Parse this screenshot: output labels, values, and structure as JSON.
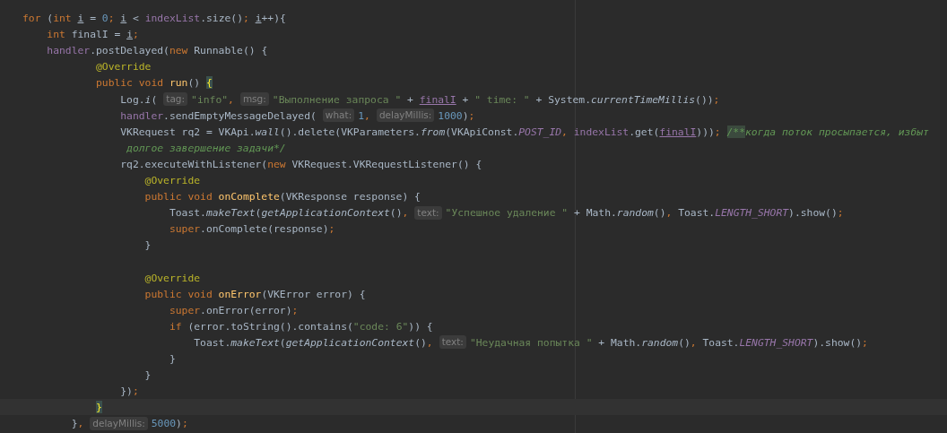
{
  "editor": {
    "lines": [
      {
        "parts": [
          {
            "kind": "code",
            "tokens": [
              {
                "kind": "kw",
                "text": "for"
              },
              {
                "kind": "plain",
                "text": " ("
              },
              {
                "kind": "kw",
                "text": "int "
              },
              {
                "kind": "uvar",
                "text": "i"
              },
              {
                "kind": "plain",
                "text": " = "
              },
              {
                "kind": "num",
                "text": "0"
              },
              {
                "kind": "kw",
                "text": "; "
              },
              {
                "kind": "uvar",
                "text": "i"
              },
              {
                "kind": "plain",
                "text": " < "
              },
              {
                "kind": "field",
                "text": "indexList"
              },
              {
                "kind": "plain",
                "text": ".size()"
              },
              {
                "kind": "kw",
                "text": "; "
              },
              {
                "kind": "uvar",
                "text": "i"
              },
              {
                "kind": "plain",
                "text": "++){"
              }
            ]
          }
        ]
      },
      {
        "parts": [
          {
            "kind": "code",
            "tokens": [
              {
                "kind": "kw",
                "text": "    int"
              },
              {
                "kind": "plain",
                "text": " finalI = "
              },
              {
                "kind": "uvar",
                "text": "i"
              },
              {
                "kind": "kw",
                "text": ";"
              }
            ]
          }
        ]
      },
      {
        "parts": [
          {
            "kind": "code",
            "tokens": [
              {
                "kind": "field",
                "text": "    handler"
              },
              {
                "kind": "plain",
                "text": ".postDelayed("
              },
              {
                "kind": "kw",
                "text": "new"
              },
              {
                "kind": "plain",
                "text": " Runnable() {"
              }
            ]
          }
        ]
      },
      {
        "parts": [
          {
            "kind": "code",
            "tokens": [
              {
                "kind": "ann",
                "text": "            @Override"
              }
            ]
          }
        ]
      },
      {
        "parts": [
          {
            "kind": "code",
            "tokens": [
              {
                "kind": "kw",
                "text": "            public void "
              },
              {
                "kind": "decl",
                "text": "run"
              },
              {
                "kind": "plain",
                "text": "() "
              },
              {
                "kind": "brace",
                "text": "{"
              }
            ]
          }
        ]
      },
      {
        "parts": [
          {
            "kind": "code",
            "tokens": [
              {
                "kind": "plain",
                "text": "                Log."
              },
              {
                "kind": "italic",
                "text": "i"
              },
              {
                "kind": "plain",
                "text": "("
              }
            ]
          },
          {
            "kind": "hint",
            "text": "tag:"
          },
          {
            "kind": "code",
            "tokens": [
              {
                "kind": "str",
                "text": "\"info\""
              },
              {
                "kind": "kw",
                "text": ","
              }
            ]
          },
          {
            "kind": "hint",
            "text": "msg:"
          },
          {
            "kind": "code",
            "tokens": [
              {
                "kind": "str",
                "text": "\"Выполнение запроса \""
              },
              {
                "kind": "plain",
                "text": " + "
              },
              {
                "kind": "ufield",
                "text": "finalI"
              },
              {
                "kind": "plain",
                "text": " + "
              },
              {
                "kind": "str",
                "text": "\" time: \""
              },
              {
                "kind": "plain",
                "text": " + System."
              },
              {
                "kind": "italic",
                "text": "currentTimeMillis"
              },
              {
                "kind": "plain",
                "text": "())"
              },
              {
                "kind": "kw",
                "text": ";"
              }
            ]
          }
        ]
      },
      {
        "parts": [
          {
            "kind": "code",
            "tokens": [
              {
                "kind": "field",
                "text": "                handler"
              },
              {
                "kind": "plain",
                "text": ".sendEmptyMessageDelayed("
              }
            ]
          },
          {
            "kind": "hint",
            "text": "what:"
          },
          {
            "kind": "code",
            "tokens": [
              {
                "kind": "num",
                "text": "1"
              },
              {
                "kind": "kw",
                "text": ","
              }
            ]
          },
          {
            "kind": "hint",
            "text": "delayMillis:"
          },
          {
            "kind": "code",
            "tokens": [
              {
                "kind": "num",
                "text": "1000"
              },
              {
                "kind": "plain",
                "text": ")"
              },
              {
                "kind": "kw",
                "text": ";"
              }
            ]
          }
        ]
      },
      {
        "parts": [
          {
            "kind": "code",
            "tokens": [
              {
                "kind": "plain",
                "text": "                VKRequest rq2 = VKApi."
              },
              {
                "kind": "italic",
                "text": "wall"
              },
              {
                "kind": "plain",
                "text": "().delete(VKParameters."
              },
              {
                "kind": "italic",
                "text": "from"
              },
              {
                "kind": "plain",
                "text": "(VKApiConst."
              },
              {
                "kind": "const",
                "text": "POST_ID"
              },
              {
                "kind": "kw",
                "text": ", "
              },
              {
                "kind": "field",
                "text": "indexList"
              },
              {
                "kind": "plain",
                "text": ".get("
              },
              {
                "kind": "ufield",
                "text": "finalI"
              },
              {
                "kind": "plain",
                "text": ")))"
              },
              {
                "kind": "kw",
                "text": "; "
              },
              {
                "kind": "docmark",
                "text": "/**"
              },
              {
                "kind": "doc",
                "text": "когда поток просыпается, избыт"
              }
            ]
          }
        ]
      },
      {
        "parts": [
          {
            "kind": "code",
            "tokens": [
              {
                "kind": "doc",
                "text": "                 долгое завершение задачи*/"
              }
            ]
          }
        ]
      },
      {
        "parts": [
          {
            "kind": "code",
            "tokens": [
              {
                "kind": "plain",
                "text": "                rq2.executeWithListener("
              },
              {
                "kind": "kw",
                "text": "new"
              },
              {
                "kind": "plain",
                "text": " VKRequest.VKRequestListener() {"
              }
            ]
          }
        ]
      },
      {
        "parts": [
          {
            "kind": "code",
            "tokens": [
              {
                "kind": "ann",
                "text": "                    @Override"
              }
            ]
          }
        ]
      },
      {
        "parts": [
          {
            "kind": "code",
            "tokens": [
              {
                "kind": "kw",
                "text": "                    public void "
              },
              {
                "kind": "decl",
                "text": "onComplete"
              },
              {
                "kind": "plain",
                "text": "(VKResponse response) {"
              }
            ]
          }
        ]
      },
      {
        "parts": [
          {
            "kind": "code",
            "tokens": [
              {
                "kind": "plain",
                "text": "                        Toast."
              },
              {
                "kind": "italic",
                "text": "makeText"
              },
              {
                "kind": "plain",
                "text": "("
              },
              {
                "kind": "italic",
                "text": "getApplicationContext"
              },
              {
                "kind": "plain",
                "text": "()"
              },
              {
                "kind": "kw",
                "text": ","
              }
            ]
          },
          {
            "kind": "hint",
            "text": "text:"
          },
          {
            "kind": "code",
            "tokens": [
              {
                "kind": "str",
                "text": "\"Успешное удаление \""
              },
              {
                "kind": "plain",
                "text": " + Math."
              },
              {
                "kind": "italic",
                "text": "random"
              },
              {
                "kind": "plain",
                "text": "()"
              },
              {
                "kind": "kw",
                "text": ","
              },
              {
                "kind": "plain",
                "text": " Toast."
              },
              {
                "kind": "const",
                "text": "LENGTH_SHORT"
              },
              {
                "kind": "plain",
                "text": ").show()"
              },
              {
                "kind": "kw",
                "text": ";"
              }
            ]
          }
        ]
      },
      {
        "parts": [
          {
            "kind": "code",
            "tokens": [
              {
                "kind": "kw",
                "text": "                        super"
              },
              {
                "kind": "plain",
                "text": ".onComplete(response)"
              },
              {
                "kind": "kw",
                "text": ";"
              }
            ]
          }
        ]
      },
      {
        "parts": [
          {
            "kind": "code",
            "tokens": [
              {
                "kind": "plain",
                "text": "                    }"
              }
            ]
          }
        ]
      },
      {
        "blank_line_before": true,
        "parts": [
          {
            "kind": "code",
            "tokens": [
              {
                "kind": "ann",
                "text": "                    @Override"
              }
            ]
          }
        ]
      },
      {
        "parts": [
          {
            "kind": "code",
            "tokens": [
              {
                "kind": "kw",
                "text": "                    public void "
              },
              {
                "kind": "decl",
                "text": "onError"
              },
              {
                "kind": "plain",
                "text": "(VKError error) {"
              }
            ]
          }
        ]
      },
      {
        "parts": [
          {
            "kind": "code",
            "tokens": [
              {
                "kind": "kw",
                "text": "                        super"
              },
              {
                "kind": "plain",
                "text": ".onError(error)"
              },
              {
                "kind": "kw",
                "text": ";"
              }
            ]
          }
        ]
      },
      {
        "parts": [
          {
            "kind": "code",
            "tokens": [
              {
                "kind": "kw",
                "text": "                        if"
              },
              {
                "kind": "plain",
                "text": " (error.toString().contains("
              },
              {
                "kind": "str",
                "text": "\"code: 6\""
              },
              {
                "kind": "plain",
                "text": ")) {"
              }
            ]
          }
        ]
      },
      {
        "parts": [
          {
            "kind": "code",
            "tokens": [
              {
                "kind": "plain",
                "text": "                            Toast."
              },
              {
                "kind": "italic",
                "text": "makeText"
              },
              {
                "kind": "plain",
                "text": "("
              },
              {
                "kind": "italic",
                "text": "getApplicationContext"
              },
              {
                "kind": "plain",
                "text": "()"
              },
              {
                "kind": "kw",
                "text": ","
              }
            ]
          },
          {
            "kind": "hint",
            "text": "text:"
          },
          {
            "kind": "code",
            "tokens": [
              {
                "kind": "str",
                "text": "\"Неудачная попытка \""
              },
              {
                "kind": "plain",
                "text": " + Math."
              },
              {
                "kind": "italic",
                "text": "random"
              },
              {
                "kind": "plain",
                "text": "()"
              },
              {
                "kind": "kw",
                "text": ","
              },
              {
                "kind": "plain",
                "text": " Toast."
              },
              {
                "kind": "const",
                "text": "LENGTH_SHORT"
              },
              {
                "kind": "plain",
                "text": ").show()"
              },
              {
                "kind": "kw",
                "text": ";"
              }
            ]
          }
        ]
      },
      {
        "parts": [
          {
            "kind": "code",
            "tokens": [
              {
                "kind": "plain",
                "text": "                        }"
              }
            ]
          }
        ]
      },
      {
        "parts": [
          {
            "kind": "code",
            "tokens": [
              {
                "kind": "plain",
                "text": "                    }"
              }
            ]
          }
        ]
      },
      {
        "parts": [
          {
            "kind": "code",
            "tokens": [
              {
                "kind": "plain",
                "text": "                })"
              },
              {
                "kind": "kw",
                "text": ";"
              }
            ]
          }
        ]
      },
      {
        "current": true,
        "parts": [
          {
            "kind": "code",
            "tokens": [
              {
                "kind": "brace",
                "text": "            }"
              }
            ]
          }
        ]
      },
      {
        "parts": [
          {
            "kind": "code",
            "tokens": [
              {
                "kind": "plain",
                "text": "        }"
              },
              {
                "kind": "kw",
                "text": ","
              }
            ]
          },
          {
            "kind": "hint",
            "text": "delayMillis:"
          },
          {
            "kind": "code",
            "tokens": [
              {
                "kind": "num",
                "text": "5000"
              },
              {
                "kind": "plain",
                "text": ")"
              },
              {
                "kind": "kw",
                "text": ";"
              }
            ]
          }
        ]
      }
    ]
  }
}
